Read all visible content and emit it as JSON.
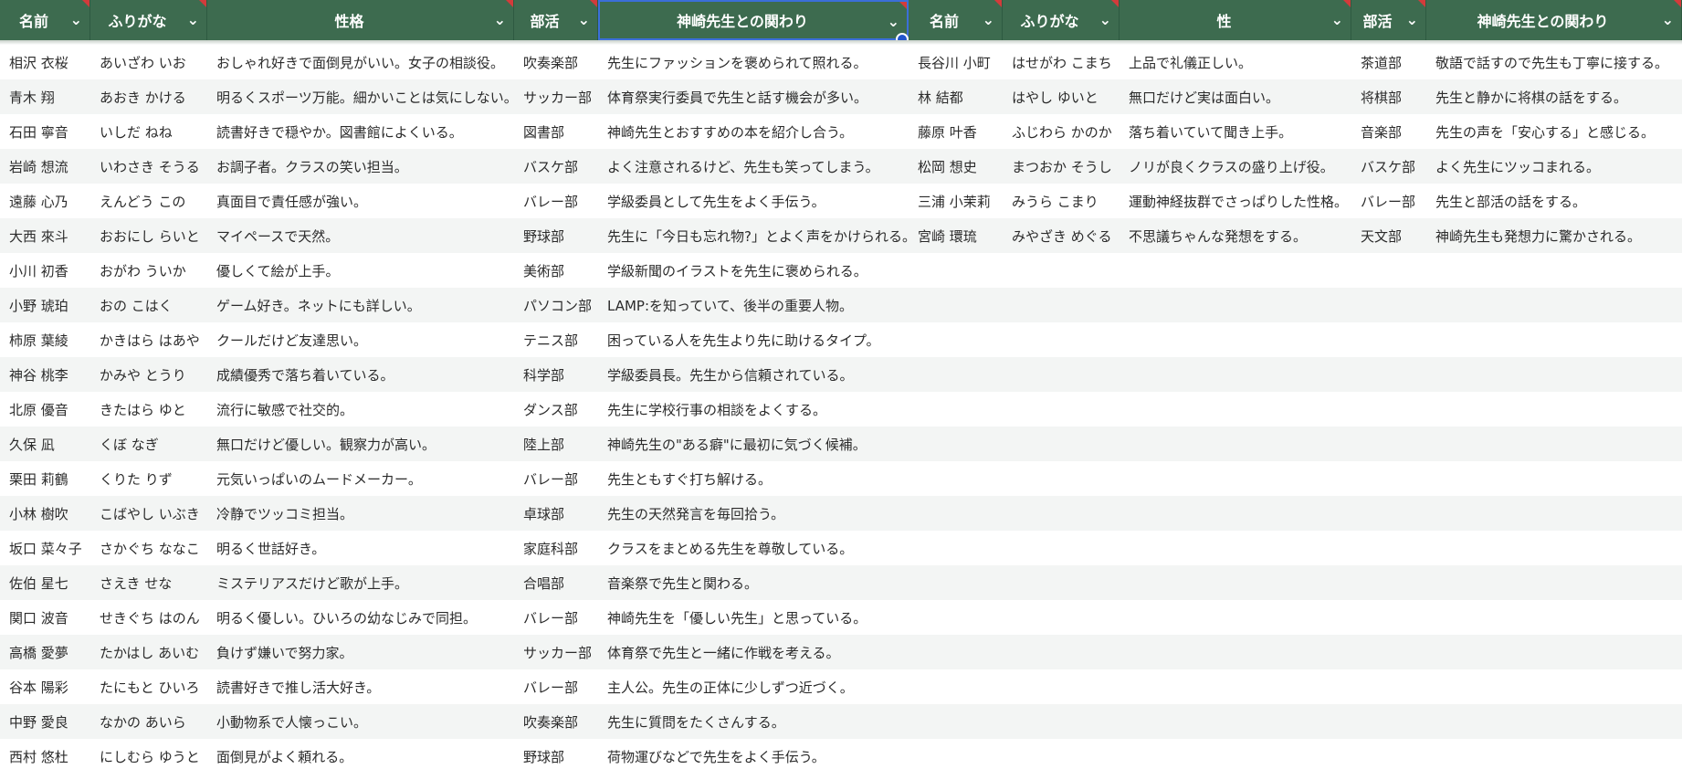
{
  "headers": [
    "名前",
    "ふりがな",
    "性格",
    "部活",
    "神崎先生との関わり",
    "名前",
    "ふりがな",
    "性",
    "部活",
    "神崎先生との関わり"
  ],
  "rows": [
    [
      "相沢 衣桜",
      "あいざわ いお",
      "おしゃれ好きで面倒見がいい。女子の相談役。",
      "吹奏楽部",
      "先生にファッションを褒められて照れる。",
      "長谷川 小町",
      "はせがわ こまち",
      "上品で礼儀正しい。",
      "茶道部",
      "敬語で話すので先生も丁寧に接する。"
    ],
    [
      "青木 翔",
      "あおき かける",
      "明るくスポーツ万能。細かいことは気にしない。",
      "サッカー部",
      "体育祭実行委員で先生と話す機会が多い。",
      "林 結都",
      "はやし ゆいと",
      "無口だけど実は面白い。",
      "将棋部",
      "先生と静かに将棋の話をする。"
    ],
    [
      "石田 寧音",
      "いしだ ねね",
      "読書好きで穏やか。図書館によくいる。",
      "図書部",
      "神崎先生とおすすめの本を紹介し合う。",
      "藤原 叶香",
      "ふじわら かのか",
      "落ち着いていて聞き上手。",
      "音楽部",
      "先生の声を「安心する」と感じる。"
    ],
    [
      "岩崎 想流",
      "いわさき そうる",
      "お調子者。クラスの笑い担当。",
      "バスケ部",
      "よく注意されるけど、先生も笑ってしまう。",
      "松岡 想史",
      "まつおか そうし",
      "ノリが良くクラスの盛り上げ役。",
      "バスケ部",
      "よく先生にツッコまれる。"
    ],
    [
      "遠藤 心乃",
      "えんどう この",
      "真面目で責任感が強い。",
      "バレー部",
      "学級委員として先生をよく手伝う。",
      "三浦 小茉莉",
      "みうら こまり",
      "運動神経抜群でさっぱりした性格。",
      "バレー部",
      "先生と部活の話をする。"
    ],
    [
      "大西 來斗",
      "おおにし らいと",
      "マイペースで天然。",
      "野球部",
      "先生に「今日も忘れ物?」とよく声をかけられる。",
      "宮崎 環琉",
      "みやざき めぐる",
      "不思議ちゃんな発想をする。",
      "天文部",
      "神崎先生も発想力に驚かされる。"
    ],
    [
      "小川 初香",
      "おがわ ういか",
      "優しくて絵が上手。",
      "美術部",
      "学級新聞のイラストを先生に褒められる。",
      "",
      "",
      "",
      "",
      ""
    ],
    [
      "小野 琥珀",
      "おの こはく",
      "ゲーム好き。ネットにも詳しい。",
      "パソコン部",
      "LAMP:を知っていて、後半の重要人物。",
      "",
      "",
      "",
      "",
      ""
    ],
    [
      "柿原 葉綾",
      "かきはら はあや",
      "クールだけど友達思い。",
      "テニス部",
      "困っている人を先生より先に助けるタイプ。",
      "",
      "",
      "",
      "",
      ""
    ],
    [
      "神谷 桃李",
      "かみや とうり",
      "成績優秀で落ち着いている。",
      "科学部",
      "学級委員長。先生から信頼されている。",
      "",
      "",
      "",
      "",
      ""
    ],
    [
      "北原 優音",
      "きたはら ゆと",
      "流行に敏感で社交的。",
      "ダンス部",
      "先生に学校行事の相談をよくする。",
      "",
      "",
      "",
      "",
      ""
    ],
    [
      "久保 凪",
      "くぼ なぎ",
      "無口だけど優しい。観察力が高い。",
      "陸上部",
      "神崎先生の\"ある癖\"に最初に気づく候補。",
      "",
      "",
      "",
      "",
      ""
    ],
    [
      "栗田 莉鶴",
      "くりた りず",
      "元気いっぱいのムードメーカー。",
      "バレー部",
      "先生ともすぐ打ち解ける。",
      "",
      "",
      "",
      "",
      ""
    ],
    [
      "小林 樹吹",
      "こばやし いぶき",
      "冷静でツッコミ担当。",
      "卓球部",
      "先生の天然発言を毎回拾う。",
      "",
      "",
      "",
      "",
      ""
    ],
    [
      "坂口 菜々子",
      "さかぐち ななこ",
      "明るく世話好き。",
      "家庭科部",
      "クラスをまとめる先生を尊敬している。",
      "",
      "",
      "",
      "",
      ""
    ],
    [
      "佐伯 星七",
      "さえき せな",
      "ミステリアスだけど歌が上手。",
      "合唱部",
      "音楽祭で先生と関わる。",
      "",
      "",
      "",
      "",
      ""
    ],
    [
      "関口 波音",
      "せきぐち はのん",
      "明るく優しい。ひいろの幼なじみで同担。",
      "バレー部",
      "神崎先生を「優しい先生」と思っている。",
      "",
      "",
      "",
      "",
      ""
    ],
    [
      "高橋 愛夢",
      "たかはし あいむ",
      "負けず嫌いで努力家。",
      "サッカー部",
      "体育祭で先生と一緒に作戦を考える。",
      "",
      "",
      "",
      "",
      ""
    ],
    [
      "谷本 陽彩",
      "たにもと ひいろ",
      "読書好きで推し活大好き。",
      "バレー部",
      "主人公。先生の正体に少しずつ近づく。",
      "",
      "",
      "",
      "",
      ""
    ],
    [
      "中野 愛良",
      "なかの あいら",
      "小動物系で人懐っこい。",
      "吹奏楽部",
      "先生に質問をたくさんする。",
      "",
      "",
      "",
      "",
      ""
    ],
    [
      "西村 悠杜",
      "にしむら ゆうと",
      "面倒見がよく頼れる。",
      "野球部",
      "荷物運びなどで先生をよく手伝う。",
      "",
      "",
      "",
      "",
      ""
    ]
  ]
}
